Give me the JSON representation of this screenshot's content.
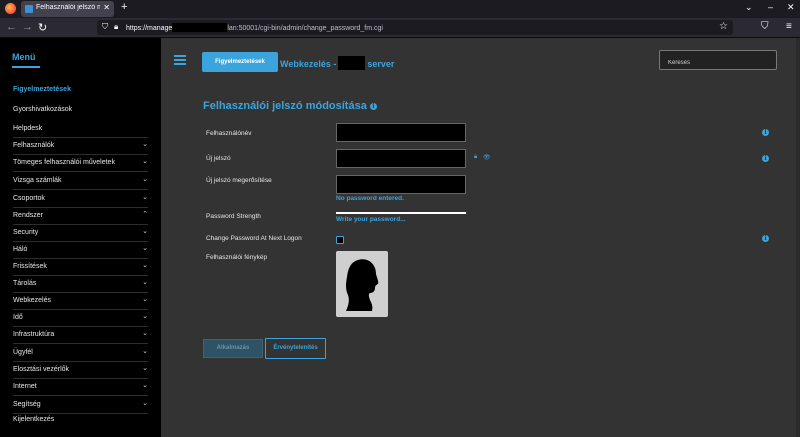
{
  "browser": {
    "tab_title": "Felhasználói jelszó módosí",
    "tab_close": "✕",
    "new_tab": "+",
    "url_prefix": "https://manage",
    "url_suffix": "lan:50001/cgi-bin/admin/change_password_fm.cgi"
  },
  "sidebar": {
    "title": "Menü",
    "items": [
      {
        "label": "Figyelmeztetések",
        "active": true,
        "chevron": ""
      },
      {
        "label": "Gyorshivatkozások",
        "active": false,
        "chevron": ""
      },
      {
        "label": "Helpdesk",
        "active": false,
        "chevron": ""
      },
      {
        "label": "Felhasználók",
        "active": false,
        "chevron": "⌄"
      },
      {
        "label": "Tömeges felhasználói műveletek",
        "active": false,
        "chevron": "⌄"
      },
      {
        "label": "Vizsga számlák",
        "active": false,
        "chevron": "⌄"
      },
      {
        "label": "Csoportok",
        "active": false,
        "chevron": "⌄"
      },
      {
        "label": "Rendszer",
        "active": false,
        "chevron": "⌃"
      },
      {
        "label": "Security",
        "active": false,
        "chevron": "⌄"
      },
      {
        "label": "Háló",
        "active": false,
        "chevron": "⌄"
      },
      {
        "label": "Frissítések",
        "active": false,
        "chevron": "⌄"
      },
      {
        "label": "Tárolás",
        "active": false,
        "chevron": "⌄"
      },
      {
        "label": "Webkezelés",
        "active": false,
        "chevron": "⌄"
      },
      {
        "label": "Idő",
        "active": false,
        "chevron": "⌄"
      },
      {
        "label": "Infrastruktúra",
        "active": false,
        "chevron": "⌄"
      },
      {
        "label": "Ügyfél",
        "active": false,
        "chevron": "⌄"
      },
      {
        "label": "Elosztási vezérlők",
        "active": false,
        "chevron": "⌄"
      },
      {
        "label": "Internet",
        "active": false,
        "chevron": "⌄"
      },
      {
        "label": "Segítség",
        "active": false,
        "chevron": "⌄"
      },
      {
        "label": "Kijelentkezés",
        "active": false,
        "chevron": ""
      }
    ]
  },
  "header": {
    "alerts_button": "Figyelmeztetések",
    "brand_prefix": "Webkezelés -",
    "brand_suffix": "server",
    "search_placeholder": "Keresés"
  },
  "form": {
    "title": "Felhasználói jelszó módosítása",
    "info_glyph": "i",
    "username_label": "Felhasználónév",
    "new_password_label": "Új jelszó",
    "confirm_label": "Új jelszó megerősítése",
    "no_password_msg": "No password entered.",
    "strength_label": "Password Strength",
    "strength_hint": "Write your password...",
    "strength_level": 1.0,
    "change_at_logon_label": "Change Password At Next Logon",
    "photo_label": "Felhasználói fénykép",
    "apply_button": "Alkalmazás",
    "cancel_button": "Érvénytelenítés"
  },
  "colors": {
    "accent": "#3ba4dc",
    "main_bg": "#333333",
    "sidebar_bg": "#000000"
  }
}
